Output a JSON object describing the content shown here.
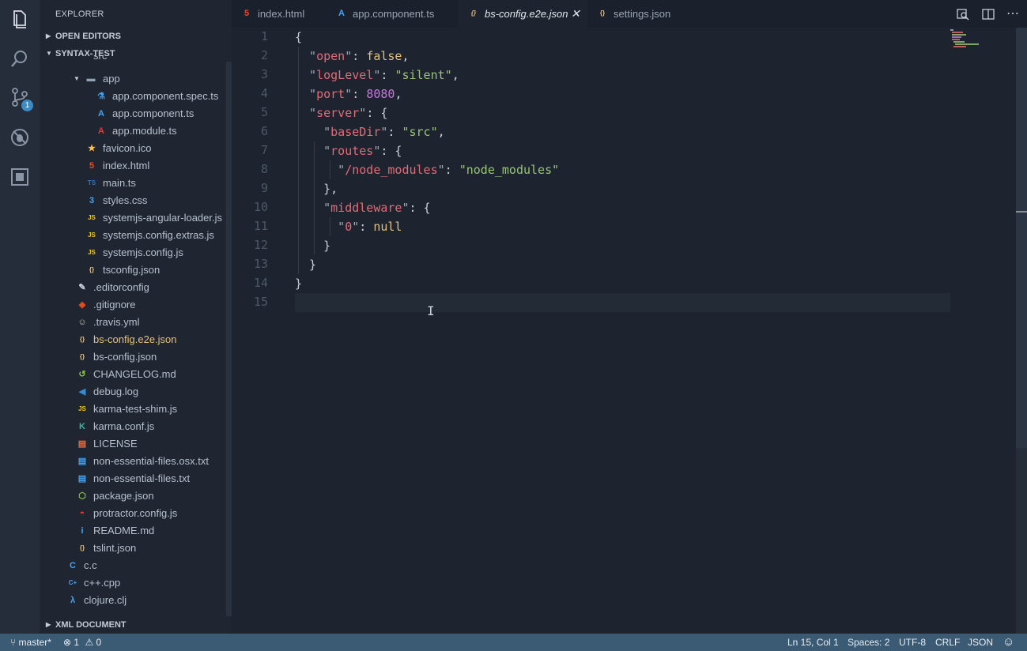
{
  "sidebar": {
    "title": "EXPLORER",
    "open_editors": "OPEN EDITORS",
    "project": "SYNTAX-TEST",
    "partial_top": "src",
    "xml_section": "XML DOCUMENT",
    "tree": [
      {
        "label": "app",
        "icon": "folder-icon",
        "glyph": "▬",
        "color": "#8fa3b8"
      },
      {
        "label": "app.component.spec.ts",
        "icon": "flask-icon",
        "glyph": "⚗",
        "color": "#42a5f5"
      },
      {
        "label": "app.component.ts",
        "icon": "angular-icon",
        "glyph": "A",
        "color": "#42a5f5"
      },
      {
        "label": "app.module.ts",
        "icon": "angular-icon",
        "glyph": "A",
        "color": "#e53935"
      },
      {
        "label": "favicon.ico",
        "icon": "star-icon",
        "glyph": "★",
        "color": "#ffca28"
      },
      {
        "label": "index.html",
        "icon": "html5-icon",
        "glyph": "5",
        "color": "#e44d26"
      },
      {
        "label": "main.ts",
        "icon": "typescript-icon",
        "glyph": "TS",
        "color": "#2f74c0"
      },
      {
        "label": "styles.css",
        "icon": "css3-icon",
        "glyph": "3",
        "color": "#42a5f5"
      },
      {
        "label": "systemjs-angular-loader.js",
        "icon": "javascript-icon",
        "glyph": "JS",
        "color": "#f0c419"
      },
      {
        "label": "systemjs.config.extras.js",
        "icon": "javascript-icon",
        "glyph": "JS",
        "color": "#f0c419"
      },
      {
        "label": "systemjs.config.js",
        "icon": "javascript-icon",
        "glyph": "JS",
        "color": "#f0c419"
      },
      {
        "label": "tsconfig.json",
        "icon": "json-icon",
        "glyph": "{}",
        "color": "#e5c07b"
      },
      {
        "label": ".editorconfig",
        "icon": "editorconfig-icon",
        "glyph": "✎",
        "color": "#d0d6dd"
      },
      {
        "label": ".gitignore",
        "icon": "git-icon",
        "glyph": "◆",
        "color": "#e64a19"
      },
      {
        "label": ".travis.yml",
        "icon": "travis-icon",
        "glyph": "☺",
        "color": "#cbbfa8"
      },
      {
        "label": "bs-config.e2e.json",
        "icon": "json-icon",
        "glyph": "{}",
        "color": "#e5c07b"
      },
      {
        "label": "bs-config.json",
        "icon": "json-icon",
        "glyph": "{}",
        "color": "#e5c07b"
      },
      {
        "label": "CHANGELOG.md",
        "icon": "history-icon",
        "glyph": "↺",
        "color": "#8bc34a"
      },
      {
        "label": "debug.log",
        "icon": "vscode-icon",
        "glyph": "◀",
        "color": "#2f8fdb"
      },
      {
        "label": "karma-test-shim.js",
        "icon": "javascript-icon",
        "glyph": "JS",
        "color": "#f0c419"
      },
      {
        "label": "karma.conf.js",
        "icon": "karma-icon",
        "glyph": "K",
        "color": "#3ab4a6"
      },
      {
        "label": "LICENSE",
        "icon": "license-icon",
        "glyph": "▤",
        "color": "#ef6c3c"
      },
      {
        "label": "non-essential-files.osx.txt",
        "icon": "text-file-icon",
        "glyph": "▤",
        "color": "#42a5f5"
      },
      {
        "label": "non-essential-files.txt",
        "icon": "text-file-icon",
        "glyph": "▤",
        "color": "#42a5f5"
      },
      {
        "label": "package.json",
        "icon": "nodejs-icon",
        "glyph": "⬡",
        "color": "#8bc34a"
      },
      {
        "label": "protractor.config.js",
        "icon": "protractor-icon",
        "glyph": "◓",
        "color": "#e53935"
      },
      {
        "label": "README.md",
        "icon": "info-icon",
        "glyph": "i",
        "color": "#42a5f5"
      },
      {
        "label": "tslint.json",
        "icon": "json-icon",
        "glyph": "{}",
        "color": "#e5c07b"
      },
      {
        "label": "c.c",
        "icon": "c-icon",
        "glyph": "C",
        "color": "#42a5f5"
      },
      {
        "label": "c++.cpp",
        "icon": "cpp-icon",
        "glyph": "C+",
        "color": "#42a5f5"
      },
      {
        "label": "clojure.clj",
        "icon": "lambda-icon",
        "glyph": "λ",
        "color": "#42a5f5"
      }
    ]
  },
  "tabs": [
    {
      "label": "index.html",
      "icon": "html5-icon",
      "glyph": "5",
      "color": "#e44d26"
    },
    {
      "label": "app.component.ts",
      "icon": "angular-icon",
      "glyph": "A",
      "color": "#42a5f5"
    },
    {
      "label": "bs-config.e2e.json",
      "icon": "json-icon",
      "glyph": "{}",
      "color": "#e5c07b",
      "close": "✕"
    },
    {
      "label": "settings.json",
      "icon": "json-icon",
      "glyph": "{}",
      "color": "#e5c07b"
    }
  ],
  "editor": {
    "line_numbers": [
      "1",
      "2",
      "3",
      "4",
      "5",
      "6",
      "7",
      "8",
      "9",
      "10",
      "11",
      "12",
      "13",
      "14",
      "15"
    ],
    "lines": [
      [
        [
          "p",
          "{"
        ]
      ],
      [
        [
          "q",
          "  \""
        ],
        [
          "k",
          "open"
        ],
        [
          "q",
          "\""
        ],
        [
          "p",
          ": "
        ],
        [
          "b",
          "false"
        ],
        [
          "p",
          ","
        ]
      ],
      [
        [
          "q",
          "  \""
        ],
        [
          "k",
          "logLevel"
        ],
        [
          "q",
          "\""
        ],
        [
          "p",
          ": "
        ],
        [
          "s",
          "\"silent\""
        ],
        [
          "p",
          ","
        ]
      ],
      [
        [
          "q",
          "  \""
        ],
        [
          "k",
          "port"
        ],
        [
          "q",
          "\""
        ],
        [
          "p",
          ": "
        ],
        [
          "n",
          "8080"
        ],
        [
          "p",
          ","
        ]
      ],
      [
        [
          "q",
          "  \""
        ],
        [
          "k",
          "server"
        ],
        [
          "q",
          "\""
        ],
        [
          "p",
          ": {"
        ]
      ],
      [
        [
          "q",
          "    \""
        ],
        [
          "k",
          "baseDir"
        ],
        [
          "q",
          "\""
        ],
        [
          "p",
          ": "
        ],
        [
          "s",
          "\"src\""
        ],
        [
          "p",
          ","
        ]
      ],
      [
        [
          "q",
          "    \""
        ],
        [
          "k",
          "routes"
        ],
        [
          "q",
          "\""
        ],
        [
          "p",
          ": {"
        ]
      ],
      [
        [
          "q",
          "      \""
        ],
        [
          "k",
          "/node_modules"
        ],
        [
          "q",
          "\""
        ],
        [
          "p",
          ": "
        ],
        [
          "s",
          "\"node_modules\""
        ]
      ],
      [
        [
          "p",
          "    },"
        ]
      ],
      [
        [
          "q",
          "    \""
        ],
        [
          "k",
          "middleware"
        ],
        [
          "q",
          "\""
        ],
        [
          "p",
          ": {"
        ]
      ],
      [
        [
          "q",
          "      \""
        ],
        [
          "k",
          "0"
        ],
        [
          "q",
          "\""
        ],
        [
          "p",
          ": "
        ],
        [
          "b",
          "null"
        ]
      ],
      [
        [
          "p",
          "    }"
        ]
      ],
      [
        [
          "p",
          "  }"
        ]
      ],
      [
        [
          "p",
          "}"
        ]
      ],
      [
        [
          "p",
          ""
        ]
      ]
    ]
  },
  "status": {
    "branch": "master*",
    "errors": "1",
    "warnings": "0",
    "position": "Ln 15, Col 1",
    "spaces": "Spaces: 2",
    "encoding": "UTF-8",
    "eol": "CRLF",
    "language": "JSON"
  },
  "colors": {
    "status_bar": "#3b5a74",
    "badge": "#3a8cc7",
    "key": "#e06c75",
    "string": "#98c379",
    "number": "#c678dd",
    "literal": "#e5c07b"
  }
}
